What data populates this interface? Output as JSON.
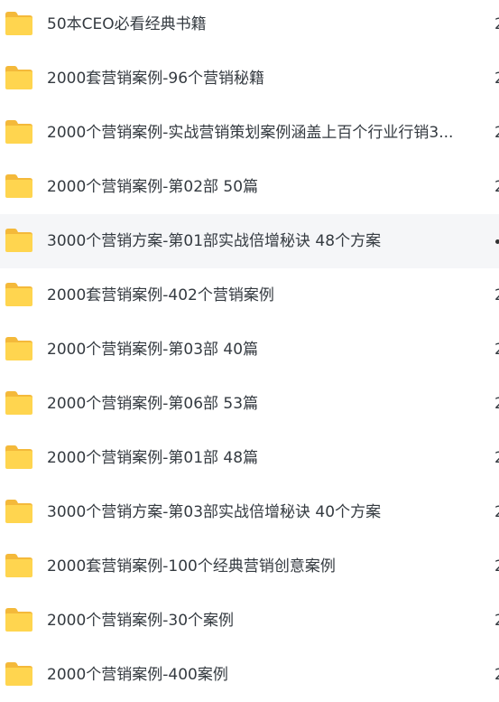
{
  "colors": {
    "folder_back": "#f4b93a",
    "folder_front": "#ffd54f",
    "text": "#343a40",
    "row_hover_bg": "#f5f6f8"
  },
  "files": [
    {
      "name": "50本CEO必看经典书籍",
      "date": "2",
      "icon": "folder-icon",
      "hovered": false
    },
    {
      "name": "2000套营销案例-96个营销秘籍",
      "date": "2",
      "icon": "folder-icon",
      "hovered": false
    },
    {
      "name": "2000个营销案例-实战营销策划案例涵盖上百个行业行销3...",
      "date": "2",
      "icon": "folder-icon",
      "hovered": false
    },
    {
      "name": "2000个营销案例-第02部 50篇",
      "date": "2",
      "icon": "folder-icon",
      "hovered": false
    },
    {
      "name": "3000个营销方案-第01部实战倍增秘诀  48个方案",
      "date": "",
      "icon": "folder-icon",
      "hovered": true
    },
    {
      "name": "2000套营销案例-402个营销案例",
      "date": "2",
      "icon": "folder-icon",
      "hovered": false
    },
    {
      "name": "2000个营销案例-第03部 40篇",
      "date": "2",
      "icon": "folder-icon",
      "hovered": false
    },
    {
      "name": "2000个营销案例-第06部 53篇",
      "date": "2",
      "icon": "folder-icon",
      "hovered": false
    },
    {
      "name": "2000个营销案例-第01部  48篇",
      "date": "2",
      "icon": "folder-icon",
      "hovered": false
    },
    {
      "name": "3000个营销方案-第03部实战倍增秘诀 40个方案",
      "date": "2",
      "icon": "folder-icon",
      "hovered": false
    },
    {
      "name": "2000套营销案例-100个经典营销创意案例",
      "date": "2",
      "icon": "folder-icon",
      "hovered": false
    },
    {
      "name": "2000个营销案例-30个案例",
      "date": "2",
      "icon": "folder-icon",
      "hovered": false
    },
    {
      "name": "2000个营销案例-400案例",
      "date": "2",
      "icon": "folder-icon",
      "hovered": false
    }
  ]
}
